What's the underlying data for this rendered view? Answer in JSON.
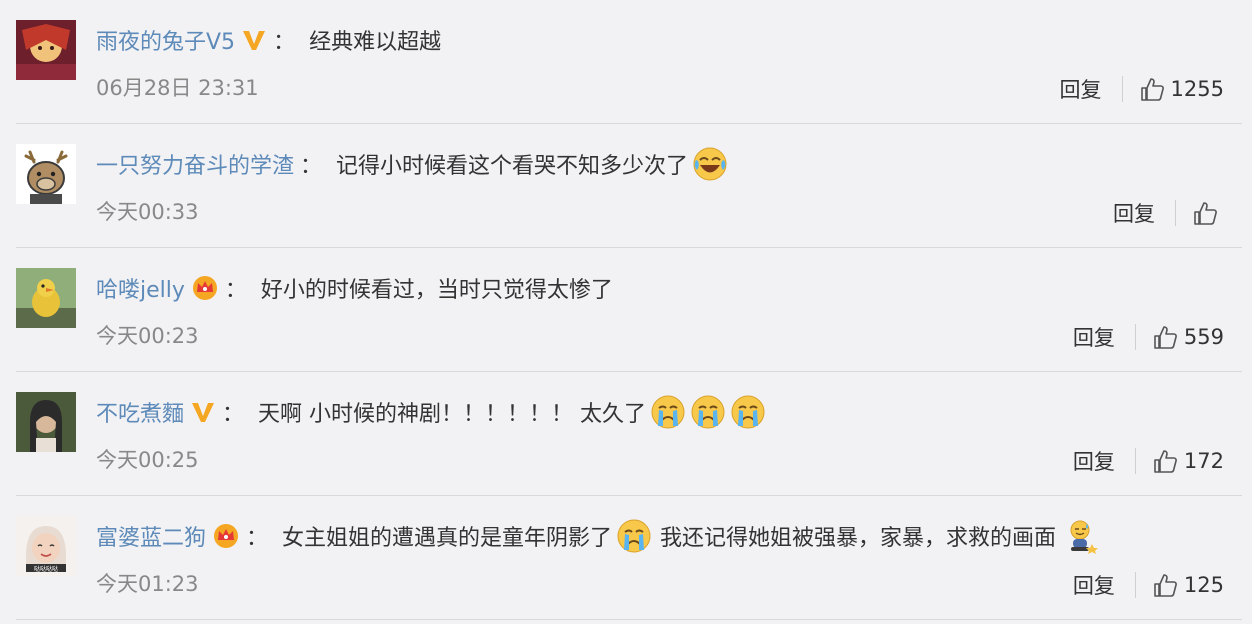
{
  "comments": [
    {
      "username": "雨夜的兔子V5",
      "badge": "v",
      "colon": "：",
      "text": "经典难以超越",
      "emojis": [],
      "timestamp": "06月28日 23:31",
      "reply_label": "回复",
      "likes": "1255",
      "avatar_colors": [
        "#c0392b",
        "#6d1f2b",
        "#f0c27a"
      ]
    },
    {
      "username": "一只努力奋斗的学渣",
      "badge": "",
      "colon": "：",
      "text": "记得小时候看这个看哭不知多少次了",
      "emojis": [
        "laugh-cry"
      ],
      "timestamp": "今天00:33",
      "reply_label": "回复",
      "likes": "",
      "avatar_colors": [
        "#ffffff",
        "#8b7a5a",
        "#3b3b3b"
      ]
    },
    {
      "username": "哈喽jelly",
      "badge": "crown",
      "colon": "：",
      "text": "好小的时候看过，当时只觉得太惨了",
      "emojis": [],
      "timestamp": "今天00:23",
      "reply_label": "回复",
      "likes": "559",
      "avatar_colors": [
        "#8fae7a",
        "#e8c33a",
        "#5c6b4a"
      ]
    },
    {
      "username": "不吃煮麵",
      "badge": "v",
      "colon": "：",
      "text": "天啊 小时候的神剧！！！！！！ 太久了",
      "emojis": [
        "crying",
        "crying",
        "crying"
      ],
      "timestamp": "今天00:25",
      "reply_label": "回复",
      "likes": "172",
      "avatar_colors": [
        "#4a5a3a",
        "#2b2b2b",
        "#d8b89a"
      ]
    },
    {
      "username": "富婆蓝二狗",
      "badge": "crown",
      "colon": "：",
      "text": "女主姐姐的遭遇真的是童年阴影了",
      "emojis": [
        "crying"
      ],
      "text2": "我还记得她姐被强暴，家暴，求救的画面",
      "emojis2": [
        "sweat-sit"
      ],
      "timestamp": "今天01:23",
      "reply_label": "回复",
      "likes": "125",
      "avatar_colors": [
        "#f5f1ee",
        "#e8c4b0",
        "#333333"
      ],
      "avatar_caption": "哒哒哒哒"
    }
  ],
  "colors": {
    "username": "#5d8ab8",
    "background": "#f2f2f5",
    "vip_badge": "#f5a623"
  }
}
